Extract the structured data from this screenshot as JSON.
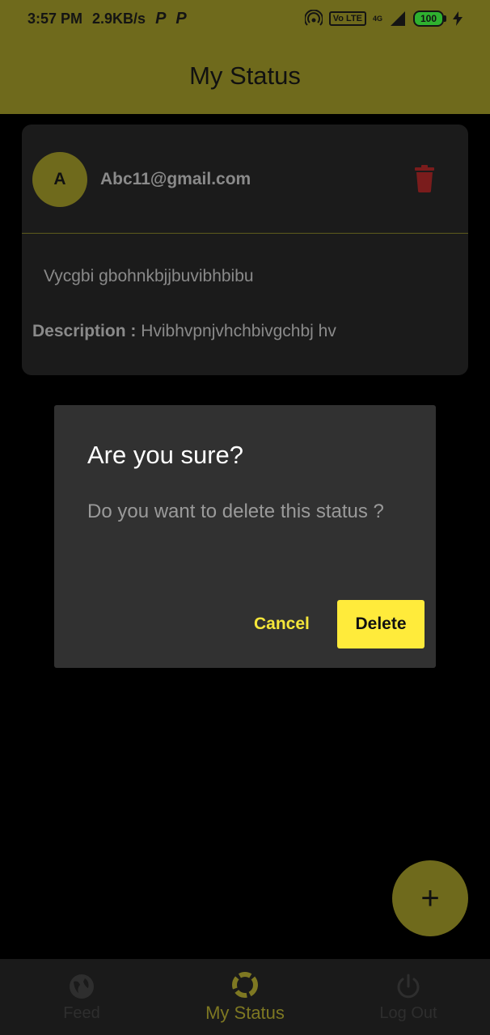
{
  "status_bar": {
    "time": "3:57 PM",
    "speed": "2.9KB/s",
    "p1": "P",
    "p2": "P",
    "volte": "Vo LTE",
    "network": "4G",
    "battery": "100"
  },
  "app_bar": {
    "title": "My Status"
  },
  "card": {
    "avatar_letter": "A",
    "email": "Abc11@gmail.com",
    "status_text": "Vycgbi gbohnkbjjbuvibhbibu",
    "description_label": "Description : ",
    "description_value": "Hvibhvpnjvhchbivgchbj hv"
  },
  "dialog": {
    "title": "Are you sure?",
    "message": "Do you want to delete this status ?",
    "cancel_label": "Cancel",
    "delete_label": "Delete"
  },
  "fab": {
    "label": "+"
  },
  "bottom_nav": {
    "items": [
      {
        "label": "Feed",
        "icon": "globe-icon"
      },
      {
        "label": "My Status",
        "icon": "status-ring-icon"
      },
      {
        "label": "Log Out",
        "icon": "power-icon"
      }
    ]
  },
  "colors": {
    "accent": "#6f6a1c",
    "dialog_button": "#ffeb3b",
    "trash": "#7a1c1c"
  }
}
